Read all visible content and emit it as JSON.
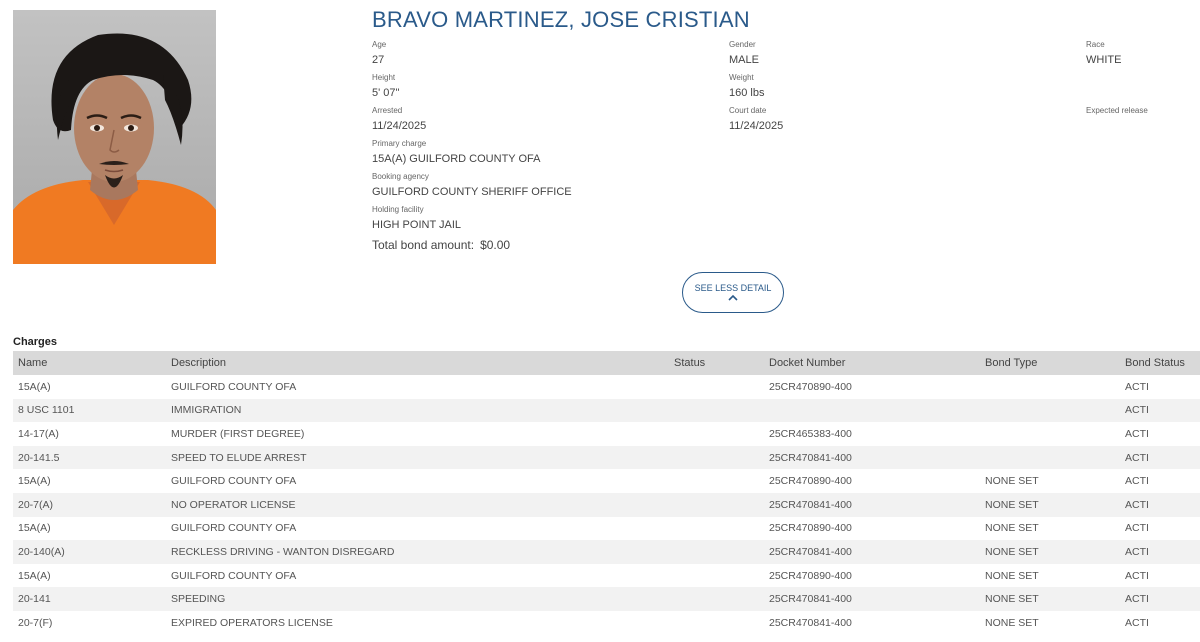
{
  "profile": {
    "name": "BRAVO MARTINEZ, JOSE CRISTIAN",
    "fields": {
      "age": {
        "label": "Age",
        "value": "27"
      },
      "gender": {
        "label": "Gender",
        "value": "MALE"
      },
      "race": {
        "label": "Race",
        "value": "WHITE"
      },
      "height": {
        "label": "Height",
        "value": "5' 07\""
      },
      "weight": {
        "label": "Weight",
        "value": "160 lbs"
      },
      "arrested": {
        "label": "Arrested",
        "value": "11/24/2025"
      },
      "court_date": {
        "label": "Court date",
        "value": "11/24/2025"
      },
      "expected_release": {
        "label": "Expected release",
        "value": ""
      },
      "primary_charge": {
        "label": "Primary charge",
        "value": "15A(A) GUILFORD COUNTY OFA"
      },
      "booking_agency": {
        "label": "Booking agency",
        "value": "GUILFORD COUNTY SHERIFF OFFICE"
      },
      "holding_facility": {
        "label": "Holding facility",
        "value": "HIGH POINT JAIL"
      }
    },
    "bond": {
      "label": "Total bond amount:",
      "value": "$0.00"
    }
  },
  "toggle": {
    "label": "SEE LESS DETAIL",
    "icon": "chevron-up-icon"
  },
  "charges": {
    "title": "Charges",
    "columns": [
      "Name",
      "Description",
      "Status",
      "Docket Number",
      "Bond Type",
      "Bond Status"
    ],
    "rows": [
      [
        "15A(A)",
        "GUILFORD COUNTY OFA",
        "",
        "25CR470890-400",
        "",
        "ACTI"
      ],
      [
        "8 USC 1101",
        "IMMIGRATION",
        "",
        "",
        "",
        "ACTI"
      ],
      [
        "14-17(A)",
        "MURDER (FIRST DEGREE)",
        "",
        "25CR465383-400",
        "",
        "ACTI"
      ],
      [
        "20-141.5",
        "SPEED TO ELUDE ARREST",
        "",
        "25CR470841-400",
        "",
        "ACTI"
      ],
      [
        "15A(A)",
        "GUILFORD COUNTY OFA",
        "",
        "25CR470890-400",
        "NONE SET",
        "ACTI"
      ],
      [
        "20-7(A)",
        "NO OPERATOR LICENSE",
        "",
        "25CR470841-400",
        "NONE SET",
        "ACTI"
      ],
      [
        "15A(A)",
        "GUILFORD COUNTY OFA",
        "",
        "25CR470890-400",
        "NONE SET",
        "ACTI"
      ],
      [
        "20-140(A)",
        "RECKLESS DRIVING - WANTON DISREGARD",
        "",
        "25CR470841-400",
        "NONE SET",
        "ACTI"
      ],
      [
        "15A(A)",
        "GUILFORD COUNTY OFA",
        "",
        "25CR470890-400",
        "NONE SET",
        "ACTI"
      ],
      [
        "20-141",
        "SPEEDING",
        "",
        "25CR470841-400",
        "NONE SET",
        "ACTI"
      ],
      [
        "20-7(F)",
        "EXPIRED OPERATORS LICENSE",
        "",
        "25CR470841-400",
        "NONE SET",
        "ACTI"
      ]
    ]
  },
  "colors": {
    "accent": "#2a5a8a",
    "header_bg": "#d9d9d9",
    "stripe": "#f2f2f2",
    "photo_shirt": "#f07a22"
  }
}
